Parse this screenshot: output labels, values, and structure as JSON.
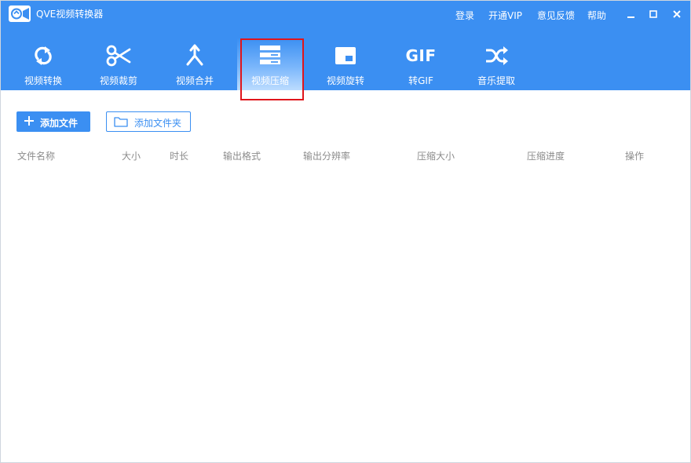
{
  "app": {
    "title": "QVE视频转换器"
  },
  "titlebar": {
    "links": {
      "login": "登录",
      "vip": "开通VIP",
      "feedback": "意见反馈",
      "help": "帮助"
    },
    "window_controls": [
      "minimize-icon",
      "maximize-icon",
      "close-icon"
    ]
  },
  "nav": {
    "items": [
      {
        "label": "视频转换",
        "icon": "refresh-icon"
      },
      {
        "label": "视频裁剪",
        "icon": "scissors-icon"
      },
      {
        "label": "视频合并",
        "icon": "merge-icon"
      },
      {
        "label": "视频压缩",
        "icon": "compress-icon",
        "active": true
      },
      {
        "label": "视频旋转",
        "icon": "rotate-icon"
      },
      {
        "label": "转GIF",
        "icon": "gif-icon",
        "icon_text": "GIF"
      },
      {
        "label": "音乐提取",
        "icon": "shuffle-icon"
      }
    ]
  },
  "toolbar": {
    "add_file": "添加文件",
    "add_folder": "添加文件夹"
  },
  "table": {
    "columns": [
      "文件名称",
      "大小",
      "时长",
      "输出格式",
      "输出分辨率",
      "压缩大小",
      "压缩进度",
      "操作"
    ]
  },
  "colors": {
    "primary": "#3b8ff2",
    "highlight": "#e0151b",
    "header_text": "#8c8c8c"
  }
}
